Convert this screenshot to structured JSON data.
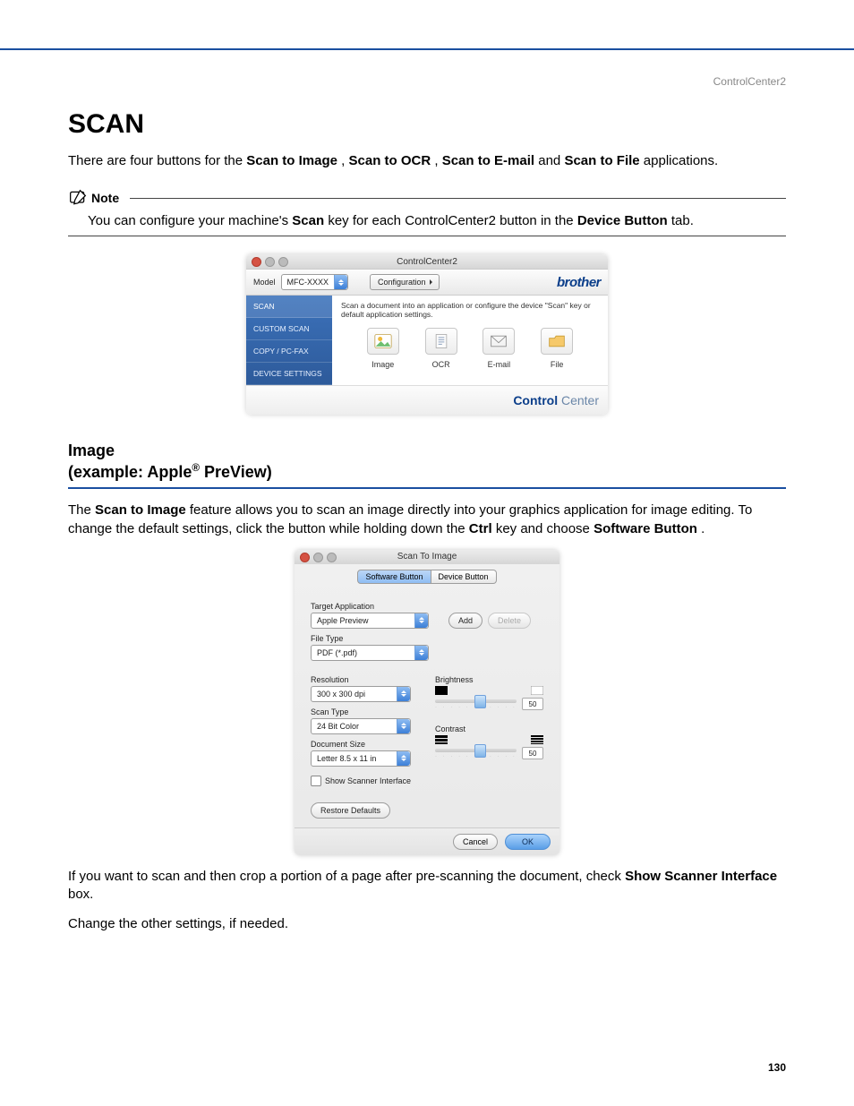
{
  "header": {
    "right": "ControlCenter2"
  },
  "title": "SCAN",
  "intro": {
    "pre": "There are four buttons for the ",
    "b1": "Scan to Image",
    "sep1": ", ",
    "b2": "Scan to OCR",
    "sep2": ", ",
    "b3": "Scan to E-mail",
    "sep3": " and ",
    "b4": "Scan to File",
    "post": " applications."
  },
  "note": {
    "label": "Note",
    "p1": "You can configure your machine's ",
    "b1": "Scan",
    "p2": " key for each ControlCenter2 button in the ",
    "b2": "Device Button",
    "p3": " tab."
  },
  "cc2": {
    "windowTitle": "ControlCenter2",
    "modelLabel": "Model",
    "modelValue": "MFC-XXXX",
    "configLabel": "Configuration",
    "brand": "brother",
    "description": "Scan a document into an application or configure the device \"Scan\" key or default application settings.",
    "sidebar": [
      "SCAN",
      "CUSTOM SCAN",
      "COPY / PC-FAX",
      "DEVICE SETTINGS"
    ],
    "buttons": [
      "Image",
      "OCR",
      "E-mail",
      "File"
    ],
    "footer": {
      "bold": "Control",
      "thin": " Center"
    }
  },
  "section2": {
    "h1": "Image",
    "h2a": " (example: Apple",
    "h2b": " PreView)",
    "sup": "®"
  },
  "para1": {
    "p1": "The ",
    "b1": "Scan to Image",
    "p2": " feature allows you to scan an image directly into your graphics application for image editing. To change the default settings, click the button while holding down the ",
    "b2": "Ctrl",
    "p3": " key and choose ",
    "b3": "Software Button",
    "p4": "."
  },
  "dlg": {
    "windowTitle": "Scan To Image",
    "tabs": [
      "Software Button",
      "Device Button"
    ],
    "targetAppLabel": "Target Application",
    "targetAppValue": "Apple Preview",
    "addLabel": "Add",
    "deleteLabel": "Delete",
    "fileTypeLabel": "File Type",
    "fileTypeValue": "PDF (*.pdf)",
    "resolutionLabel": "Resolution",
    "resolutionValue": "300 x 300 dpi",
    "scanTypeLabel": "Scan Type",
    "scanTypeValue": "24 Bit Color",
    "docSizeLabel": "Document Size",
    "docSizeValue": "Letter  8.5 x 11 in",
    "brightnessLabel": "Brightness",
    "brightnessValue": "50",
    "contrastLabel": "Contrast",
    "contrastValue": "50",
    "showScannerLabel": "Show Scanner Interface",
    "restoreLabel": "Restore Defaults",
    "cancelLabel": "Cancel",
    "okLabel": "OK"
  },
  "para2": {
    "p1": "If you want to scan and then crop a portion of a page after pre-scanning the document, check ",
    "b1": "Show Scanner Interface",
    "p2": " box."
  },
  "para3": "Change the other settings, if needed.",
  "pageNumber": "130"
}
